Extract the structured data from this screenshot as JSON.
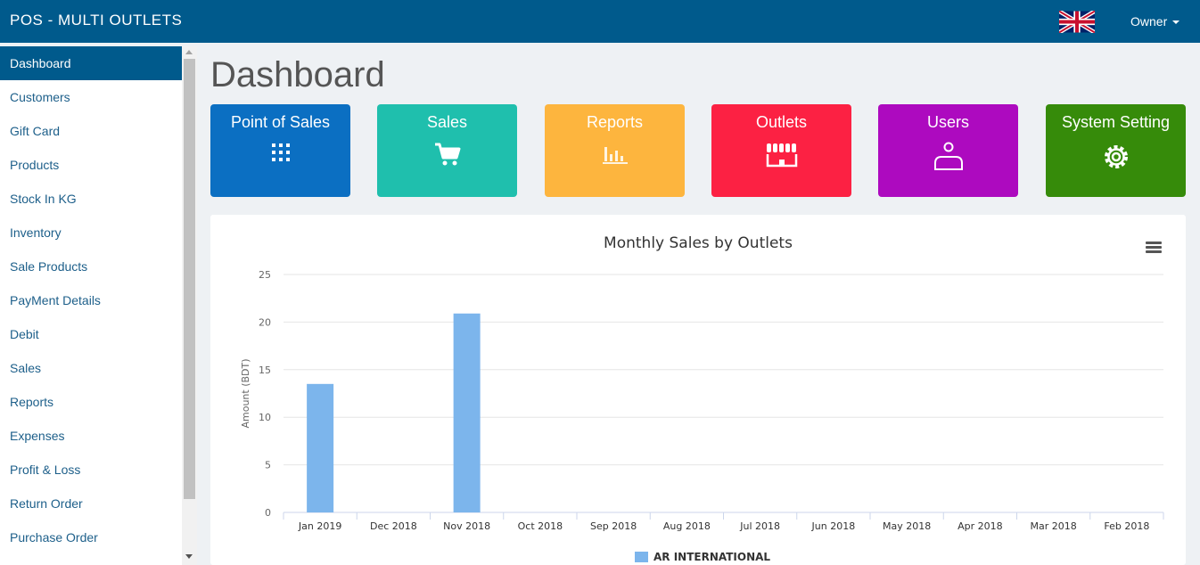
{
  "header": {
    "brand": "POS - MULTI OUTLETS",
    "user_menu_label": "Owner",
    "flag_icon": "uk-flag-icon"
  },
  "sidebar": {
    "items": [
      {
        "label": "Dashboard",
        "active": true
      },
      {
        "label": "Customers"
      },
      {
        "label": "Gift Card"
      },
      {
        "label": "Products"
      },
      {
        "label": "Stock In KG"
      },
      {
        "label": "Inventory"
      },
      {
        "label": "Sale Products"
      },
      {
        "label": "PayMent Details"
      },
      {
        "label": "Debit"
      },
      {
        "label": "Sales"
      },
      {
        "label": "Reports"
      },
      {
        "label": "Expenses"
      },
      {
        "label": "Profit & Loss"
      },
      {
        "label": "Return Order"
      },
      {
        "label": "Purchase Order"
      }
    ]
  },
  "main": {
    "title": "Dashboard",
    "tiles": [
      {
        "label": "Point of Sales",
        "icon": "grid-icon",
        "color": "#0b6fc2"
      },
      {
        "label": "Sales",
        "icon": "cart-icon",
        "color": "#1fbfad"
      },
      {
        "label": "Reports",
        "icon": "bar-chart-icon",
        "color": "#fdb53e"
      },
      {
        "label": "Outlets",
        "icon": "store-icon",
        "color": "#fc2143"
      },
      {
        "label": "Users",
        "icon": "user-icon",
        "color": "#ad0abf"
      },
      {
        "label": "System Setting",
        "icon": "gear-icon",
        "color": "#368b0a"
      }
    ]
  },
  "chart_data": {
    "type": "bar",
    "title": "Monthly Sales by Outlets",
    "xlabel": "",
    "ylabel": "Amount (BDT)",
    "ylim": [
      0,
      25
    ],
    "yticks": [
      0,
      5,
      10,
      15,
      20,
      25
    ],
    "grid": true,
    "legend_position": "bottom-center",
    "categories": [
      "Jan 2019",
      "Dec 2018",
      "Nov 2018",
      "Oct 2018",
      "Sep 2018",
      "Aug 2018",
      "Jul 2018",
      "Jun 2018",
      "May 2018",
      "Apr 2018",
      "Mar 2018",
      "Feb 2018"
    ],
    "series": [
      {
        "name": "AR INTERNATIONAL",
        "color": "#7cb5ec",
        "values": [
          13.5,
          0,
          20.9,
          0,
          0,
          0,
          0,
          0,
          0,
          0,
          0,
          0
        ]
      }
    ]
  }
}
